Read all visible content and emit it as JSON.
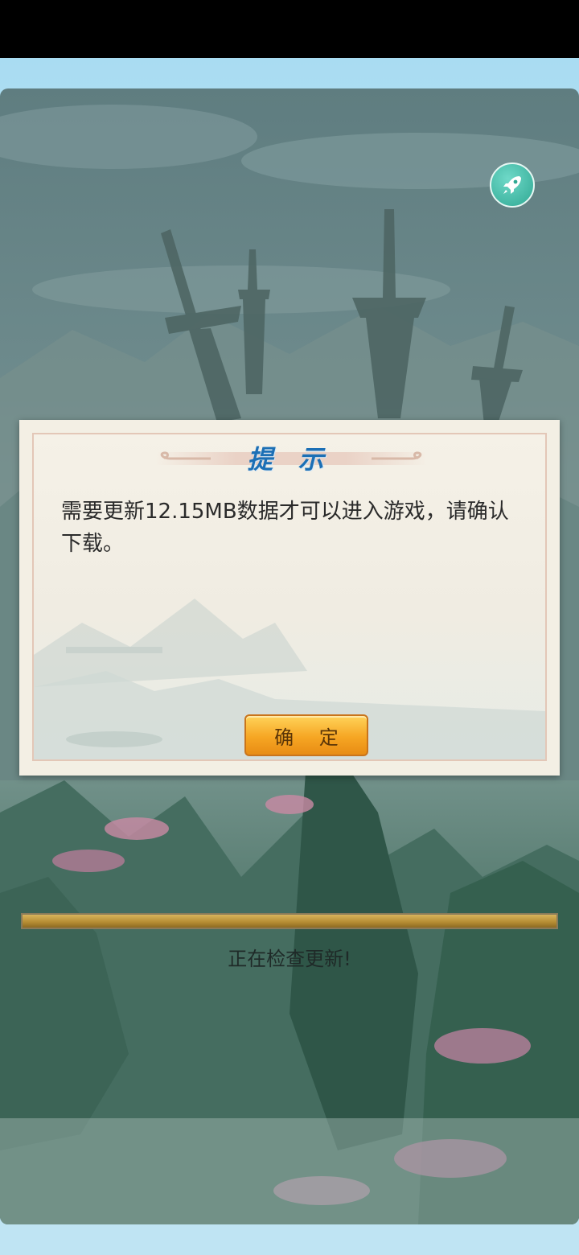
{
  "dialog": {
    "title": "提 示",
    "message": "需要更新12.15MB数据才可以进入游戏，请确认下载。",
    "confirm_label": "确 定"
  },
  "loading": {
    "status_text": "正在检查更新!",
    "progress": 1.0
  },
  "icons": {
    "speed_button": "rocket-icon"
  },
  "colors": {
    "title": "#1c6fb5",
    "button": "#f6a623",
    "rocket_button": "#2fa893",
    "frame": "#a9dcf2"
  }
}
